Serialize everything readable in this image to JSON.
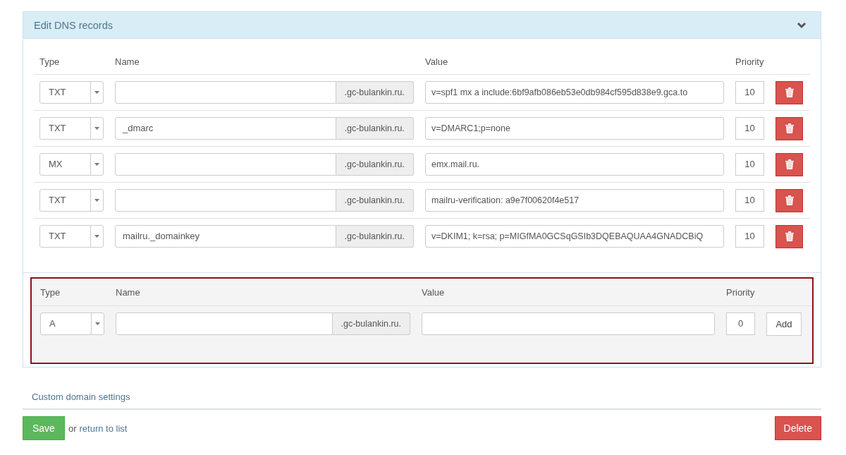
{
  "panel": {
    "title": "Edit DNS records",
    "expanded": true
  },
  "records": {
    "columns": [
      "Type",
      "Name",
      "Value",
      "Priority"
    ],
    "rows": [
      {
        "type": "TXT",
        "suffix": ".gc-bulankin.ru.",
        "value": "v=spf1 mx a include:6bf9afb086eb53e0db984cf595d838e9.gca.to",
        "priority": "10"
      },
      {
        "type": "TXT",
        "name": "_dmarc",
        "suffix": ".gc-bulankin.ru.",
        "value": "v=DMARC1;p=none",
        "priority": "10"
      },
      {
        "type": "MX",
        "suffix": ".gc-bulankin.ru.",
        "value": "emx.mail.ru.",
        "priority": "10"
      },
      {
        "type": "TXT",
        "suffix": ".gc-bulankin.ru.",
        "value": "mailru-verification: a9e7f00620f4e517",
        "priority": "10"
      },
      {
        "type": "TXT",
        "name": "mailru._domainkey",
        "suffix": ".gc-bulankin.ru.",
        "value": "v=DKIM1; k=rsa; p=MIGfMA0GCSqGSIb3DQEBAQUAA4GNADCBiQ",
        "priority": "10"
      }
    ]
  },
  "new_record": {
    "columns": [
      "Type",
      "Name",
      "Value",
      "Priority"
    ],
    "type": "A",
    "suffix": ".gc-bulankin.ru.",
    "priority": "0",
    "button": "Add"
  },
  "custom_link": "Custom domain settings",
  "footer": {
    "save": "Save",
    "or_text": "or",
    "return_link": "return to list",
    "delete": "Delete"
  }
}
